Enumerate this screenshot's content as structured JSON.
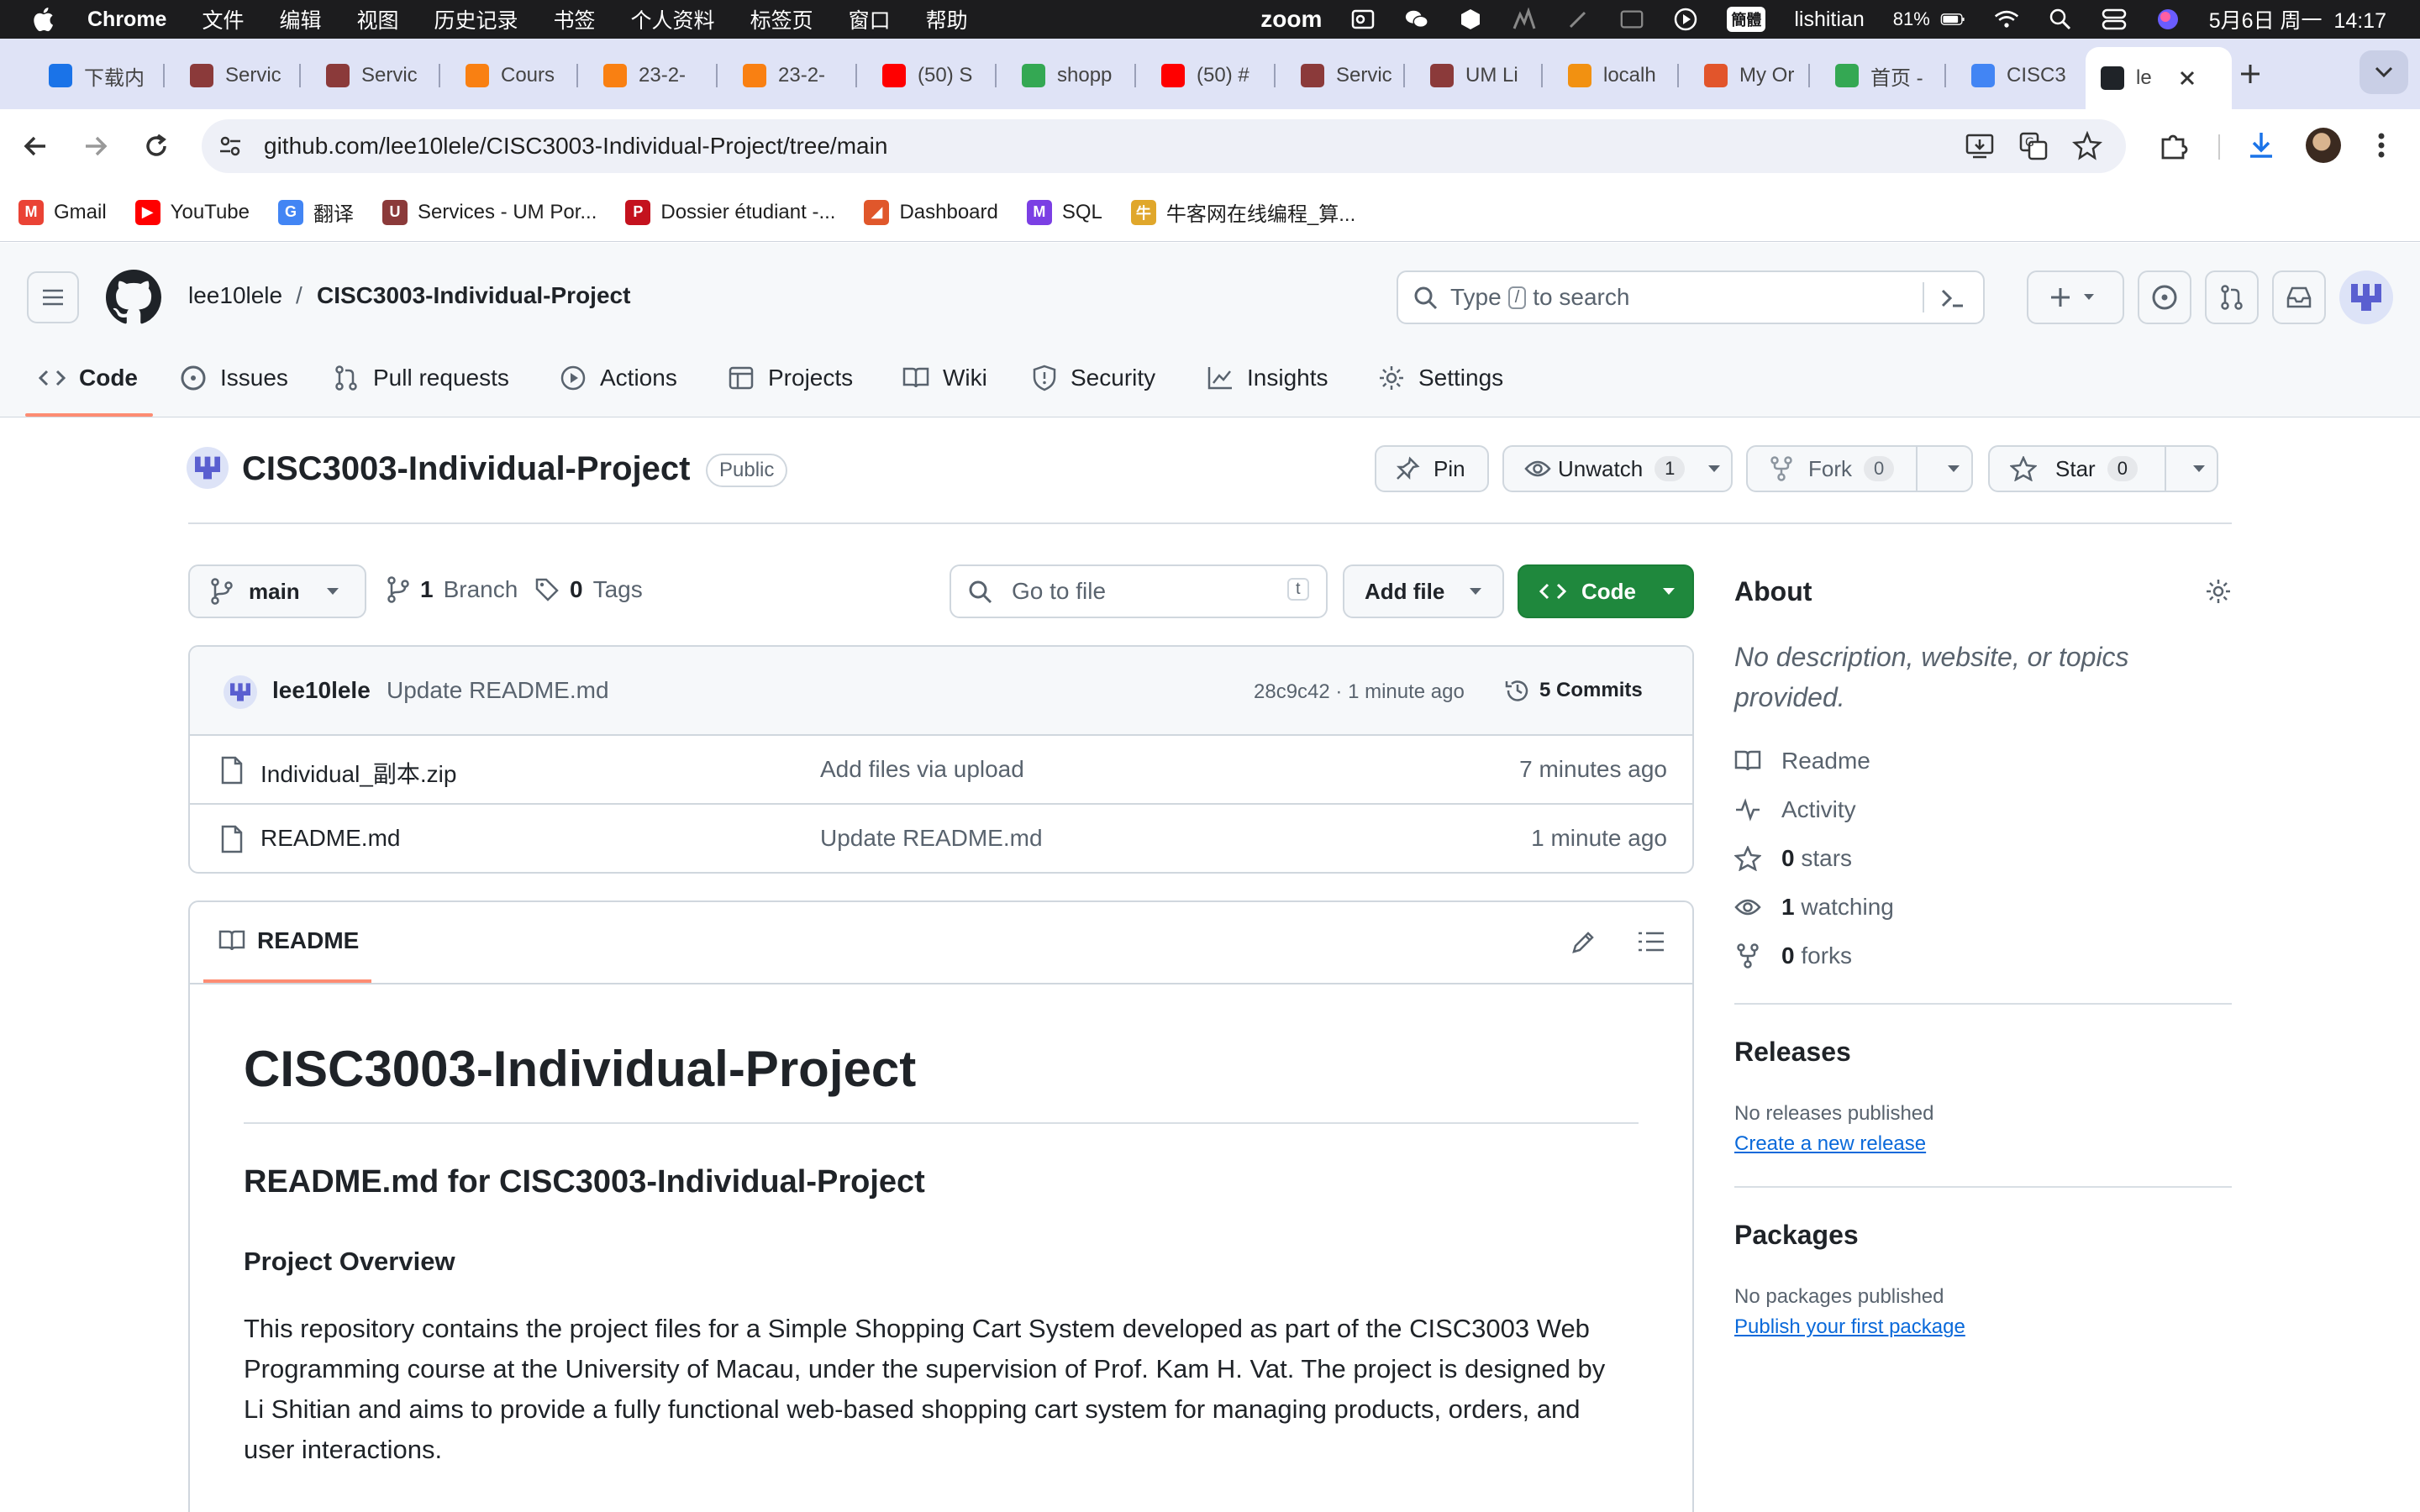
{
  "menubar": {
    "app": "Chrome",
    "items": [
      "文件",
      "编辑",
      "视图",
      "历史记录",
      "书签",
      "个人资料",
      "标签页",
      "窗口",
      "帮助"
    ],
    "status_app": "zoom",
    "ime_badge": "簡體",
    "user": "lishitian",
    "battery": "81%",
    "datetime": "5月6日 周一  14:17"
  },
  "tabs": [
    {
      "label": "下载内",
      "icon": "download-icon",
      "color": "#1a73e8"
    },
    {
      "label": "Servic",
      "icon": "um-portal-icon",
      "color": "#8b3a3a"
    },
    {
      "label": "Servic",
      "icon": "um-portal-icon",
      "color": "#8b3a3a"
    },
    {
      "label": "Cours",
      "icon": "moodle-icon",
      "color": "#f98012"
    },
    {
      "label": "23-2-",
      "icon": "moodle-icon",
      "color": "#f98012"
    },
    {
      "label": "23-2-",
      "icon": "moodle-icon",
      "color": "#f98012"
    },
    {
      "label": "(50) S",
      "icon": "youtube-icon",
      "color": "#ff0000"
    },
    {
      "label": "shopp",
      "icon": "drive-icon",
      "color": "#34a853"
    },
    {
      "label": "(50) #",
      "icon": "youtube-icon",
      "color": "#ff0000"
    },
    {
      "label": "Servic",
      "icon": "um-portal-icon",
      "color": "#8b3a3a"
    },
    {
      "label": "UM Li",
      "icon": "um-portal-icon",
      "color": "#8b3a3a"
    },
    {
      "label": "localh",
      "icon": "phpmyadmin-icon",
      "color": "#f29111"
    },
    {
      "label": "My Or",
      "icon": "app-icon",
      "color": "#e2552b"
    },
    {
      "label": "首页 -",
      "icon": "drive-icon",
      "color": "#34a853"
    },
    {
      "label": "CISC3",
      "icon": "docs-icon",
      "color": "#4285f4"
    },
    {
      "label": "le",
      "icon": "github-icon",
      "color": "#1f2328"
    }
  ],
  "address": {
    "url": "github.com/lee10lele/CISC3003-Individual-Project/tree/main"
  },
  "bookmarks": [
    {
      "label": "Gmail",
      "icon": "gmail-icon",
      "color": "#ea4335",
      "glyph": "M"
    },
    {
      "label": "YouTube",
      "icon": "youtube-icon",
      "color": "#ff0000",
      "glyph": "▶"
    },
    {
      "label": "翻译",
      "icon": "translate-icon",
      "color": "#4285f4",
      "glyph": "G"
    },
    {
      "label": "Services - UM Por...",
      "icon": "um-portal-icon",
      "color": "#8b3a3a",
      "glyph": "U"
    },
    {
      "label": "Dossier étudiant -...",
      "icon": "dossier-icon",
      "color": "#c4121e",
      "glyph": "P"
    },
    {
      "label": "Dashboard",
      "icon": "dashboard-icon",
      "color": "#e0572b",
      "glyph": "◢"
    },
    {
      "label": "SQL",
      "icon": "sql-icon",
      "color": "#7b3fe4",
      "glyph": "M"
    },
    {
      "label": "牛客网在线编程_算...",
      "icon": "nowcoder-icon",
      "color": "#e0a72b",
      "glyph": "牛"
    }
  ],
  "github": {
    "owner": "lee10lele",
    "separator": "/",
    "repo": "CISC3003-Individual-Project",
    "search_placeholder_pre": "Type",
    "search_key": "/",
    "search_placeholder_post": "to search",
    "nav": [
      "Code",
      "Issues",
      "Pull requests",
      "Actions",
      "Projects",
      "Wiki",
      "Security",
      "Insights",
      "Settings"
    ],
    "repo_title": "CISC3003-Individual-Project",
    "visibility": "Public",
    "pin": "Pin",
    "unwatch": "Unwatch",
    "unwatch_count": "1",
    "fork": "Fork",
    "fork_count": "0",
    "star": "Star",
    "star_count": "0",
    "branch": "main",
    "branch_count": "1",
    "branch_label": "Branch",
    "tag_count": "0",
    "tag_label": "Tags",
    "goto_placeholder": "Go to file",
    "goto_key": "t",
    "add_file": "Add file",
    "code_btn": "Code",
    "commit": {
      "author": "lee10lele",
      "message": "Update README.md",
      "hash_time": "28c9c42 · 1 minute ago",
      "commits": "5 Commits"
    },
    "files": [
      {
        "name": "Individual_副本.zip",
        "message": "Add files via upload",
        "time": "7 minutes ago"
      },
      {
        "name": "README.md",
        "message": "Update README.md",
        "time": "1 minute ago"
      }
    ],
    "readme_tab": "README",
    "readme": {
      "h1": "CISC3003-Individual-Project",
      "h2": "README.md for CISC3003-Individual-Project",
      "h3": "Project Overview",
      "p": "This repository contains the project files for a Simple Shopping Cart System developed as part of the CISC3003 Web Programming course at the University of Macau, under the supervision of Prof. Kam H. Vat. The project is designed by Li Shitian and aims to provide a fully functional web-based shopping cart system for managing products, orders, and user interactions."
    },
    "about": {
      "title": "About",
      "desc": "No description, website, or topics provided.",
      "readme": "Readme",
      "activity": "Activity",
      "stars_n": "0",
      "stars": "stars",
      "watching_n": "1",
      "watching": "watching",
      "forks_n": "0",
      "forks": "forks"
    },
    "releases": {
      "title": "Releases",
      "none": "No releases published",
      "link": "Create a new release"
    },
    "packages": {
      "title": "Packages",
      "none": "No packages published",
      "link": "Publish your first package"
    }
  }
}
